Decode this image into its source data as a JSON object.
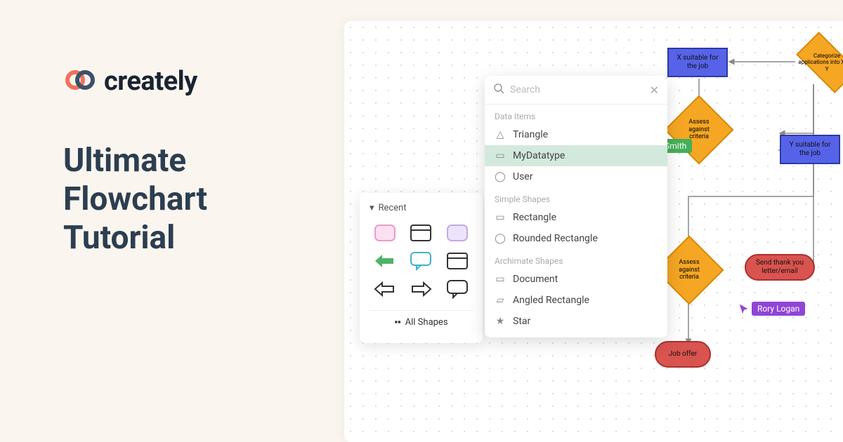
{
  "brand": {
    "name": "creately"
  },
  "heading": {
    "line1": "Ultimate",
    "line2": "Flowchart",
    "line3": "Tutorial"
  },
  "shapes_panel": {
    "recent_label": "Recent",
    "all_shapes_label": "All Shapes"
  },
  "search_popup": {
    "placeholder": "Search",
    "groups": [
      {
        "label": "Data Items",
        "items": [
          "Triangle",
          "MyDatatype",
          "User"
        ],
        "selected_index": 1
      },
      {
        "label": "Simple Shapes",
        "items": [
          "Rectangle",
          "Rounded Rectangle"
        ]
      },
      {
        "label": "Archimate Shapes",
        "items": [
          "Document",
          "Angled Rectangle",
          "Star"
        ]
      }
    ]
  },
  "cursors": {
    "user1": "Mark Smith",
    "user2": "Rory Logan"
  },
  "flowchart": {
    "nodes": {
      "categorize": "Categorize applications into X and Y",
      "x_suitable": "X suitable for the job",
      "y_suitable": "Y suitable for the job",
      "assess1": "Assess against criteria",
      "assess2": "Assess against criteria",
      "send_thanks": "Send thank you letter/email",
      "job_offer": "Job offer"
    }
  }
}
